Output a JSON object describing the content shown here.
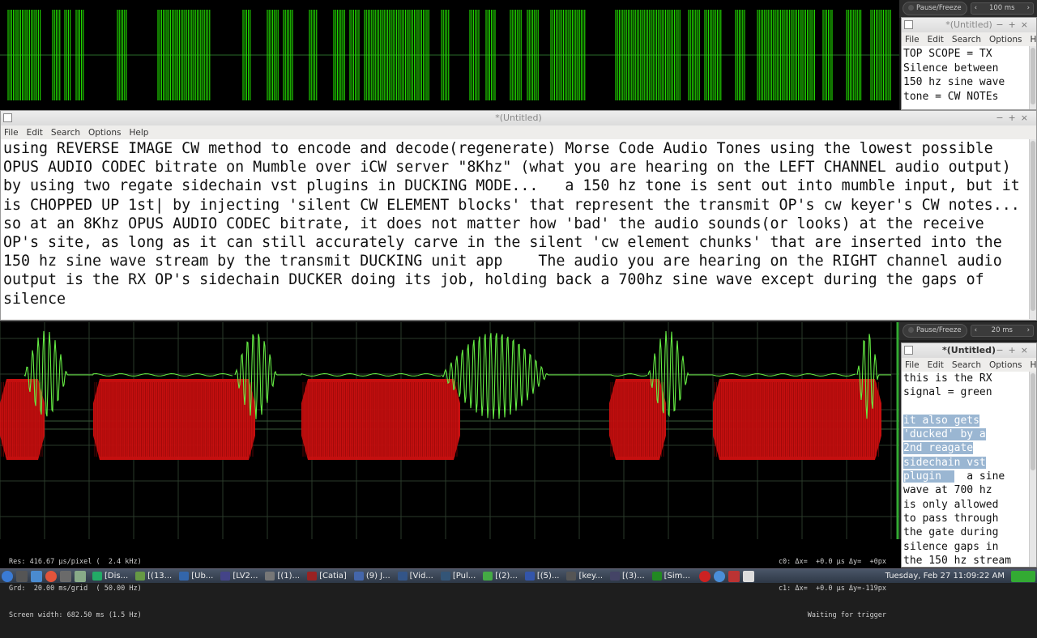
{
  "top_controls": {
    "pause_label": "Pause/Freeze",
    "time_value": "100 ms"
  },
  "bottom_controls": {
    "pause_label": "Pause/Freeze",
    "time_value": "20 ms"
  },
  "editor_main": {
    "title": "*(Untitled)",
    "menu": [
      "File",
      "Edit",
      "Search",
      "Options",
      "Help"
    ],
    "text": "using REVERSE IMAGE CW method to encode and decode(regenerate) Morse Code Audio Tones using the lowest possible OPUS AUDIO CODEC bitrate on Mumble over iCW server \"8Khz\" (what you are hearing on the LEFT CHANNEL audio output) by using two regate sidechain vst plugins in DUCKING MODE...   a 150 hz tone is sent out into mumble input, but it is CHOPPED UP 1st| by injecting 'silent CW ELEMENT blocks' that represent the transmit OP's cw keyer's CW notes... so at an 8Khz OPUS AUDIO CODEC bitrate, it does not matter how 'bad' the audio sounds(or looks) at the receive OP's site, as long as it can still accurately carve in the silent 'cw element chunks' that are inserted into the 150 hz sine wave stream by the transmit DUCKING unit app    The audio you are hearing on the RIGHT channel audio output is the RX OP's sidechain DUCKER doing its job, holding back a 700hz sine wave except during the gaps of silence"
  },
  "editor_top": {
    "title": "*(Untitled)",
    "menu": [
      "File",
      "Edit",
      "Search",
      "Options",
      "Help"
    ],
    "text": "TOP SCOPE = TX\nSilence between\n150 hz sine wave\ntone = CW NOTEs"
  },
  "editor_right": {
    "title": "*(Untitled)",
    "menu": [
      "File",
      "Edit",
      "Search",
      "Options",
      "Help"
    ],
    "text_normal_1": "this is the RX\nsignal = green\n\n",
    "text_selected": "it also gets\n'ducked' by a\n2nd reagate\nsidechain vst\nplugin  ",
    "text_normal_2": "  a sine\nwave at 700 hz\nis only allowed\nto pass through\nthe gate during\nsilence gaps in\nthe 150 hz stream"
  },
  "scope_readouts": {
    "res": "Res: 416.67 µs/pixel (  2.4 kHz)",
    "grd": "Grd:  20.00 ms/grid  ( 50.00 Hz)",
    "width": "Screen width: 682.50 ms (1.5 Hz)",
    "c0": "c0: Δx=  +0.0 µs Δy=  +0px",
    "c1": "c1: Δx=  +0.0 µs Δy=-119px",
    "trigger": "Waiting for trigger"
  },
  "taskbar": {
    "tasks": [
      "[Dis...",
      "[(13...",
      "[Ub...",
      "[LV2...",
      "[(1)...",
      "[Catia]",
      "(9) J...",
      "[Vid...",
      "[Pul...",
      "[(2)...",
      "[(5)...",
      "[key...",
      "[(3)...",
      "[Sim..."
    ],
    "clock": "Tuesday, Feb 27 11:09:22 AM"
  },
  "colors": {
    "tx_trace": "#22e000",
    "rx_trace": "#66ee44",
    "tx_red": "#d01010",
    "scope_bg": "#000000",
    "grid": "#2a3a2a"
  }
}
